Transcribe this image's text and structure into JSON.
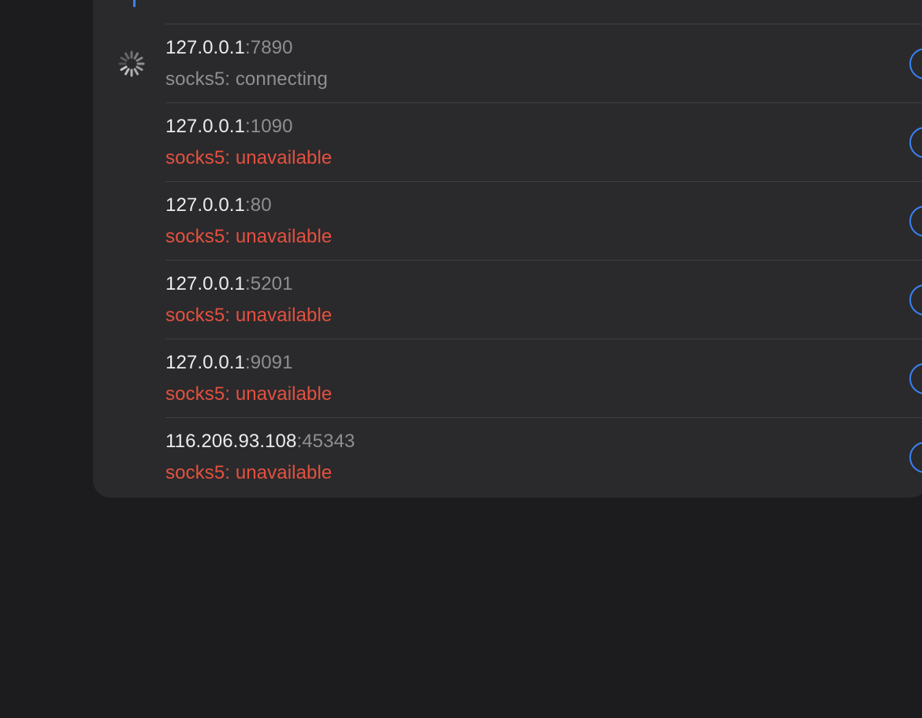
{
  "proxy_list": {
    "partial_top_row": {
      "text": "…"
    },
    "items": [
      {
        "host": "127.0.0.1",
        "port": "7890",
        "status": "socks5: connecting",
        "state": "connecting",
        "loading": true
      },
      {
        "host": "127.0.0.1",
        "port": "1090",
        "status": "socks5: unavailable",
        "state": "unavailable",
        "loading": false
      },
      {
        "host": "127.0.0.1",
        "port": "80",
        "status": "socks5: unavailable",
        "state": "unavailable",
        "loading": false
      },
      {
        "host": "127.0.0.1",
        "port": "5201",
        "status": "socks5: unavailable",
        "state": "unavailable",
        "loading": false
      },
      {
        "host": "127.0.0.1",
        "port": "9091",
        "status": "socks5: unavailable",
        "state": "unavailable",
        "loading": false
      },
      {
        "host": "116.206.93.108",
        "port": "45343",
        "status": "socks5: unavailable",
        "state": "unavailable",
        "loading": false
      }
    ]
  },
  "colors": {
    "background": "#1c1c1e",
    "card": "#2a2a2c",
    "accent": "#3a82f7",
    "error": "#e5503f",
    "secondary_text": "#8e8e93",
    "primary_text": "#ececee"
  },
  "icons": {
    "spinner": "loading-spinner-icon",
    "radio": "radio-unselected-icon"
  }
}
